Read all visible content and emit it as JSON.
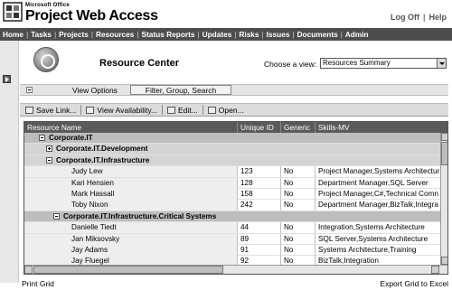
{
  "brand": {
    "company": "Microsoft Office",
    "product": "Project Web Access"
  },
  "top_links": [
    "Log Off",
    "Help"
  ],
  "nav": [
    "Home",
    "Tasks",
    "Projects",
    "Resources",
    "Status Reports",
    "Updates",
    "Risks",
    "Issues",
    "Documents",
    "Admin"
  ],
  "page": {
    "title": "Resource Center",
    "view_label": "Choose a view:",
    "view_selected": "Resources Summary"
  },
  "options": {
    "tab_view": "View Options",
    "tab_filter": "Filter, Group, Search"
  },
  "toolbar": {
    "save_link": "Save Link...",
    "view_availability": "View Availability...",
    "edit": "Edit...",
    "open": "Open..."
  },
  "grid": {
    "columns": [
      "Resource Name",
      "Unique ID",
      "Generic",
      "Skills-MV"
    ],
    "rows": [
      {
        "kind": "group1",
        "expander": "minus",
        "name": "Corporate.IT"
      },
      {
        "kind": "group2",
        "expander": "plus",
        "name": "Corporate.IT.Development"
      },
      {
        "kind": "group2",
        "expander": "minus",
        "name": "Corporate.IT.Infrastructure"
      },
      {
        "kind": "res",
        "name": "Judy Lew",
        "id": "123",
        "generic": "No",
        "skills": "Project Manager,Systems Architectur"
      },
      {
        "kind": "res",
        "name": "Kari Hensien",
        "id": "128",
        "generic": "No",
        "skills": "Department Manager,SQL Server"
      },
      {
        "kind": "res",
        "name": "Mark Hassall",
        "id": "158",
        "generic": "No",
        "skills": "Project Manager,C#,Technical Comn"
      },
      {
        "kind": "res",
        "name": "Toby Nixon",
        "id": "242",
        "generic": "No",
        "skills": "Department Manager,BizTalk,Integra"
      },
      {
        "kind": "group3",
        "expander": "minus",
        "name": "Corporate.IT.Infrastructure.Critical Systems"
      },
      {
        "kind": "res",
        "name": "Danielle Tiedt",
        "id": "44",
        "generic": "No",
        "skills": "Integration,Systems Architecture"
      },
      {
        "kind": "res",
        "name": "Jan Miksovsky",
        "id": "89",
        "generic": "No",
        "skills": "SQL Server,Systems Architecture"
      },
      {
        "kind": "res",
        "name": "Jay Adams",
        "id": "91",
        "generic": "No",
        "skills": "Systems Architecture,Training"
      },
      {
        "kind": "res",
        "name": "Jay Fluegel",
        "id": "92",
        "generic": "No",
        "skills": "BizTalk,Integration"
      }
    ]
  },
  "footer": {
    "print": "Print Grid",
    "export": "Export Grid to Excel"
  }
}
